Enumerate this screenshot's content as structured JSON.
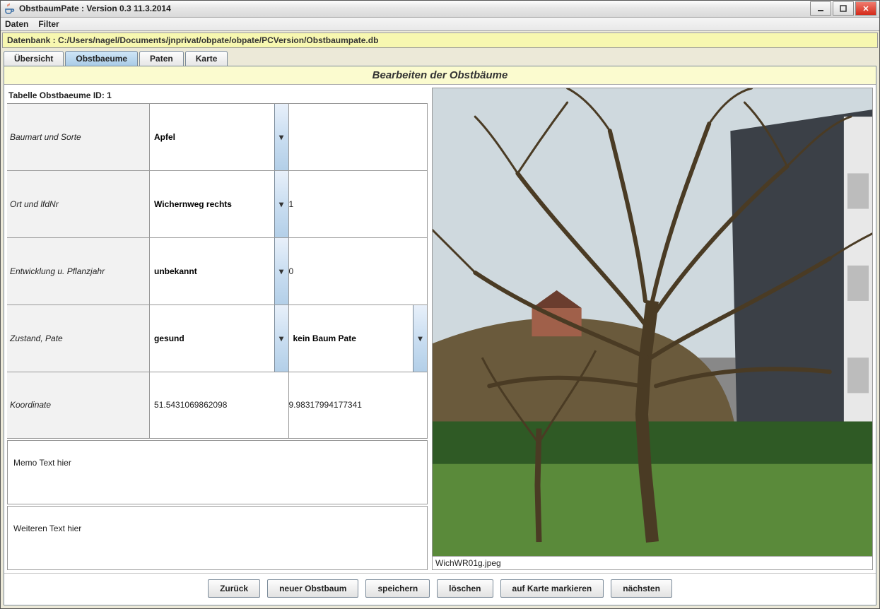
{
  "window": {
    "title": "ObstbaumPate : Version 0.3 11.3.2014"
  },
  "menu": {
    "items": [
      "Daten",
      "Filter"
    ]
  },
  "db_path_line": "Datenbank : C:/Users/nagel/Documents/jnprivat/obpate/obpate/PCVersion/Obstbaumpate.db",
  "tabs": {
    "items": [
      "Übersicht",
      "Obstbaeume",
      "Paten",
      "Karte"
    ],
    "active_index": 1
  },
  "section_title": "Bearbeiten der Obstbäume",
  "table_id_label": "Tabelle Obstbaeume ID: 1",
  "rows": [
    {
      "label": "Baumart und Sorte",
      "combo": "Apfel",
      "combo_arrow": true,
      "value": "",
      "value_is_combo": false
    },
    {
      "label": "Ort und lfdNr",
      "combo": "Wichernweg rechts",
      "combo_arrow": true,
      "value": "1",
      "value_is_combo": false
    },
    {
      "label": "Entwicklung u. Pflanzjahr",
      "combo": "unbekannt",
      "combo_arrow": true,
      "value": "0",
      "value_is_combo": false
    },
    {
      "label": "Zustand, Pate",
      "combo": "gesund",
      "combo_arrow": true,
      "value": "kein Baum Pate",
      "value_is_combo": true
    },
    {
      "label": "Koordinate",
      "combo": "51.5431069862098",
      "combo_arrow": false,
      "value": "9.98317994177341",
      "value_is_combo": false
    }
  ],
  "memo1": "Memo Text hier",
  "memo2": "Weiteren Text hier",
  "image_caption": "WichWR01g.jpeg",
  "buttons": {
    "back": "Zurück",
    "new": "neuer Obstbaum",
    "save": "speichern",
    "delete": "löschen",
    "mark_map": "auf Karte markieren",
    "next": "nächsten"
  }
}
